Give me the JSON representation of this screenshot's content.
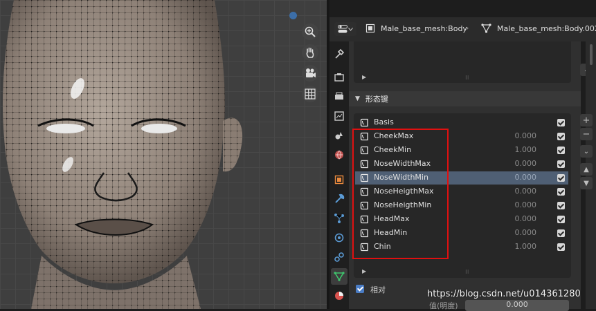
{
  "viewport": {
    "nav_icons": [
      "zoom-icon",
      "hand-pan-icon",
      "camera-icon",
      "grid-icon"
    ]
  },
  "header": {
    "object_name": "Male_base_mesh:Body",
    "mesh_name": "Male_base_mesh:Body.002"
  },
  "tabs": [
    "tool-icon",
    "render-icon",
    "output-icon",
    "view-layer-icon",
    "scene-icon",
    "world-icon",
    "object-icon",
    "modifier-icon",
    "particles-icon",
    "physics-icon",
    "constraints-icon",
    "data-icon",
    "material-icon"
  ],
  "shape_keys": {
    "title": "形态键",
    "items": [
      {
        "name": "Basis",
        "value": "",
        "selected": false
      },
      {
        "name": "CheekMax",
        "value": "0.000",
        "selected": false
      },
      {
        "name": "CheekMin",
        "value": "1.000",
        "selected": false
      },
      {
        "name": "NoseWidthMax",
        "value": "0.000",
        "selected": false
      },
      {
        "name": "NoseWidthMin",
        "value": "0.000",
        "selected": true
      },
      {
        "name": "NoseHeigthMax",
        "value": "0.000",
        "selected": false
      },
      {
        "name": "NoseHeigthMin",
        "value": "0.000",
        "selected": false
      },
      {
        "name": "HeadMax",
        "value": "0.000",
        "selected": false
      },
      {
        "name": "HeadMin",
        "value": "0.000",
        "selected": false
      },
      {
        "name": "Chin",
        "value": "1.000",
        "selected": false
      }
    ],
    "relative_label": "相对",
    "value_label": "值(明度)",
    "value": "0.000"
  },
  "watermark": "https://blog.csdn.net/u014361280",
  "colors": {
    "selection": "#4f5f74",
    "highlight_box": "#e01010",
    "accent_blue": "#4a7cc4"
  }
}
